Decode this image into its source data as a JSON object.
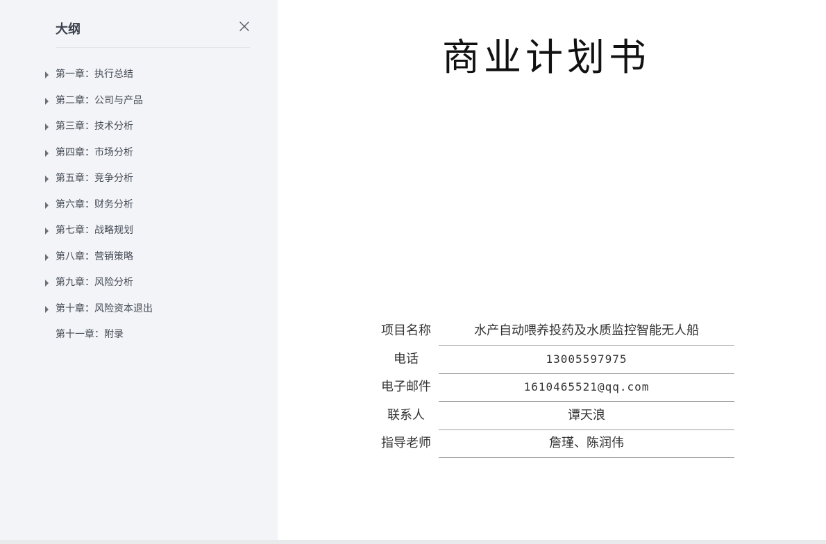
{
  "sidebar": {
    "title": "大纲",
    "close_icon": "close-icon",
    "items": [
      {
        "label": "第一章：执行总结",
        "expandable": true
      },
      {
        "label": "第二章：公司与产品",
        "expandable": true
      },
      {
        "label": "第三章：技术分析",
        "expandable": true
      },
      {
        "label": "第四章：市场分析",
        "expandable": true
      },
      {
        "label": "第五章：竞争分析",
        "expandable": true
      },
      {
        "label": "第六章：财务分析",
        "expandable": true
      },
      {
        "label": "第七章：战略规划",
        "expandable": true
      },
      {
        "label": "第八章：营销策略",
        "expandable": true
      },
      {
        "label": "第九章：风险分析",
        "expandable": true
      },
      {
        "label": "第十章：风险资本退出",
        "expandable": true
      },
      {
        "label": "第十一章：附录",
        "expandable": false
      }
    ]
  },
  "document": {
    "title": "商业计划书",
    "info": [
      {
        "label": "项目名称",
        "value": "水产自动喂养投药及水质监控智能无人船"
      },
      {
        "label": "电话",
        "value": "13005597975"
      },
      {
        "label": "电子邮件",
        "value": "1610465521@qq.com"
      },
      {
        "label": "联系人",
        "value": "谭天浪"
      },
      {
        "label": "指导老师",
        "value": "詹瑾、陈润伟"
      }
    ]
  },
  "colors": {
    "sidebar_bg": "#f3f4f7",
    "doc_bg": "#ffffff",
    "text": "#444a55"
  }
}
